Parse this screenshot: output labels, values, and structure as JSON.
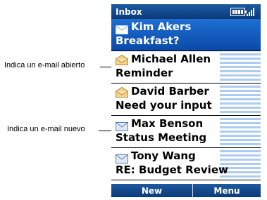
{
  "callouts": {
    "opened": "Indica un e-mail abierto",
    "new": "Indica un e-mail nuevo"
  },
  "titlebar": {
    "title": "Inbox",
    "icons": [
      "battery-icon",
      "signal-icon"
    ]
  },
  "emails": [
    {
      "sender": "Kim Akers",
      "subject": "Breakfast?",
      "status": "new",
      "selected": true
    },
    {
      "sender": "Michael Allen",
      "subject": "Reminder",
      "status": "opened"
    },
    {
      "sender": "David Barber",
      "subject": "Need your input",
      "status": "opened"
    },
    {
      "sender": "Max Benson",
      "subject": "Status Meeting",
      "status": "new"
    },
    {
      "sender": "Tony Wang",
      "subject": "RE: Budget Review",
      "status": "new"
    }
  ],
  "softkeys": {
    "left": "New",
    "right": "Menu"
  },
  "colors": {
    "bar": "#0c3a78",
    "selected": "#1f6ed3"
  }
}
